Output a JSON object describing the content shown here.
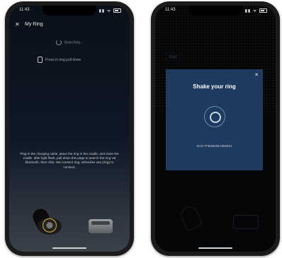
{
  "left_phone": {
    "status_time": "11:43",
    "status_icons": "▮▮ ᯤ",
    "header": {
      "close_icon": "close-icon",
      "title": "My Ring"
    },
    "searching_text": "Searching...",
    "press_text": "Press in ring pull down",
    "instructions": "Plug in the charging cable, place the ring in the cradle, and close the cradle. after light flash, pull down this page to search the ring via bluetooth, then click. We connect ring, otherwise use (ring) to connect."
  },
  "right_phone": {
    "status_time": "11:43",
    "status_icons": "▮▮ ᯤ",
    "dimmed_title": "Ring",
    "modal": {
      "close_icon": "close-icon",
      "title": "Shake your ring",
      "code": "3HC7FB2B4BAB9631"
    }
  },
  "colors": {
    "modal_bg": "#1e3a5e",
    "screen_bg": "#0a1019"
  }
}
